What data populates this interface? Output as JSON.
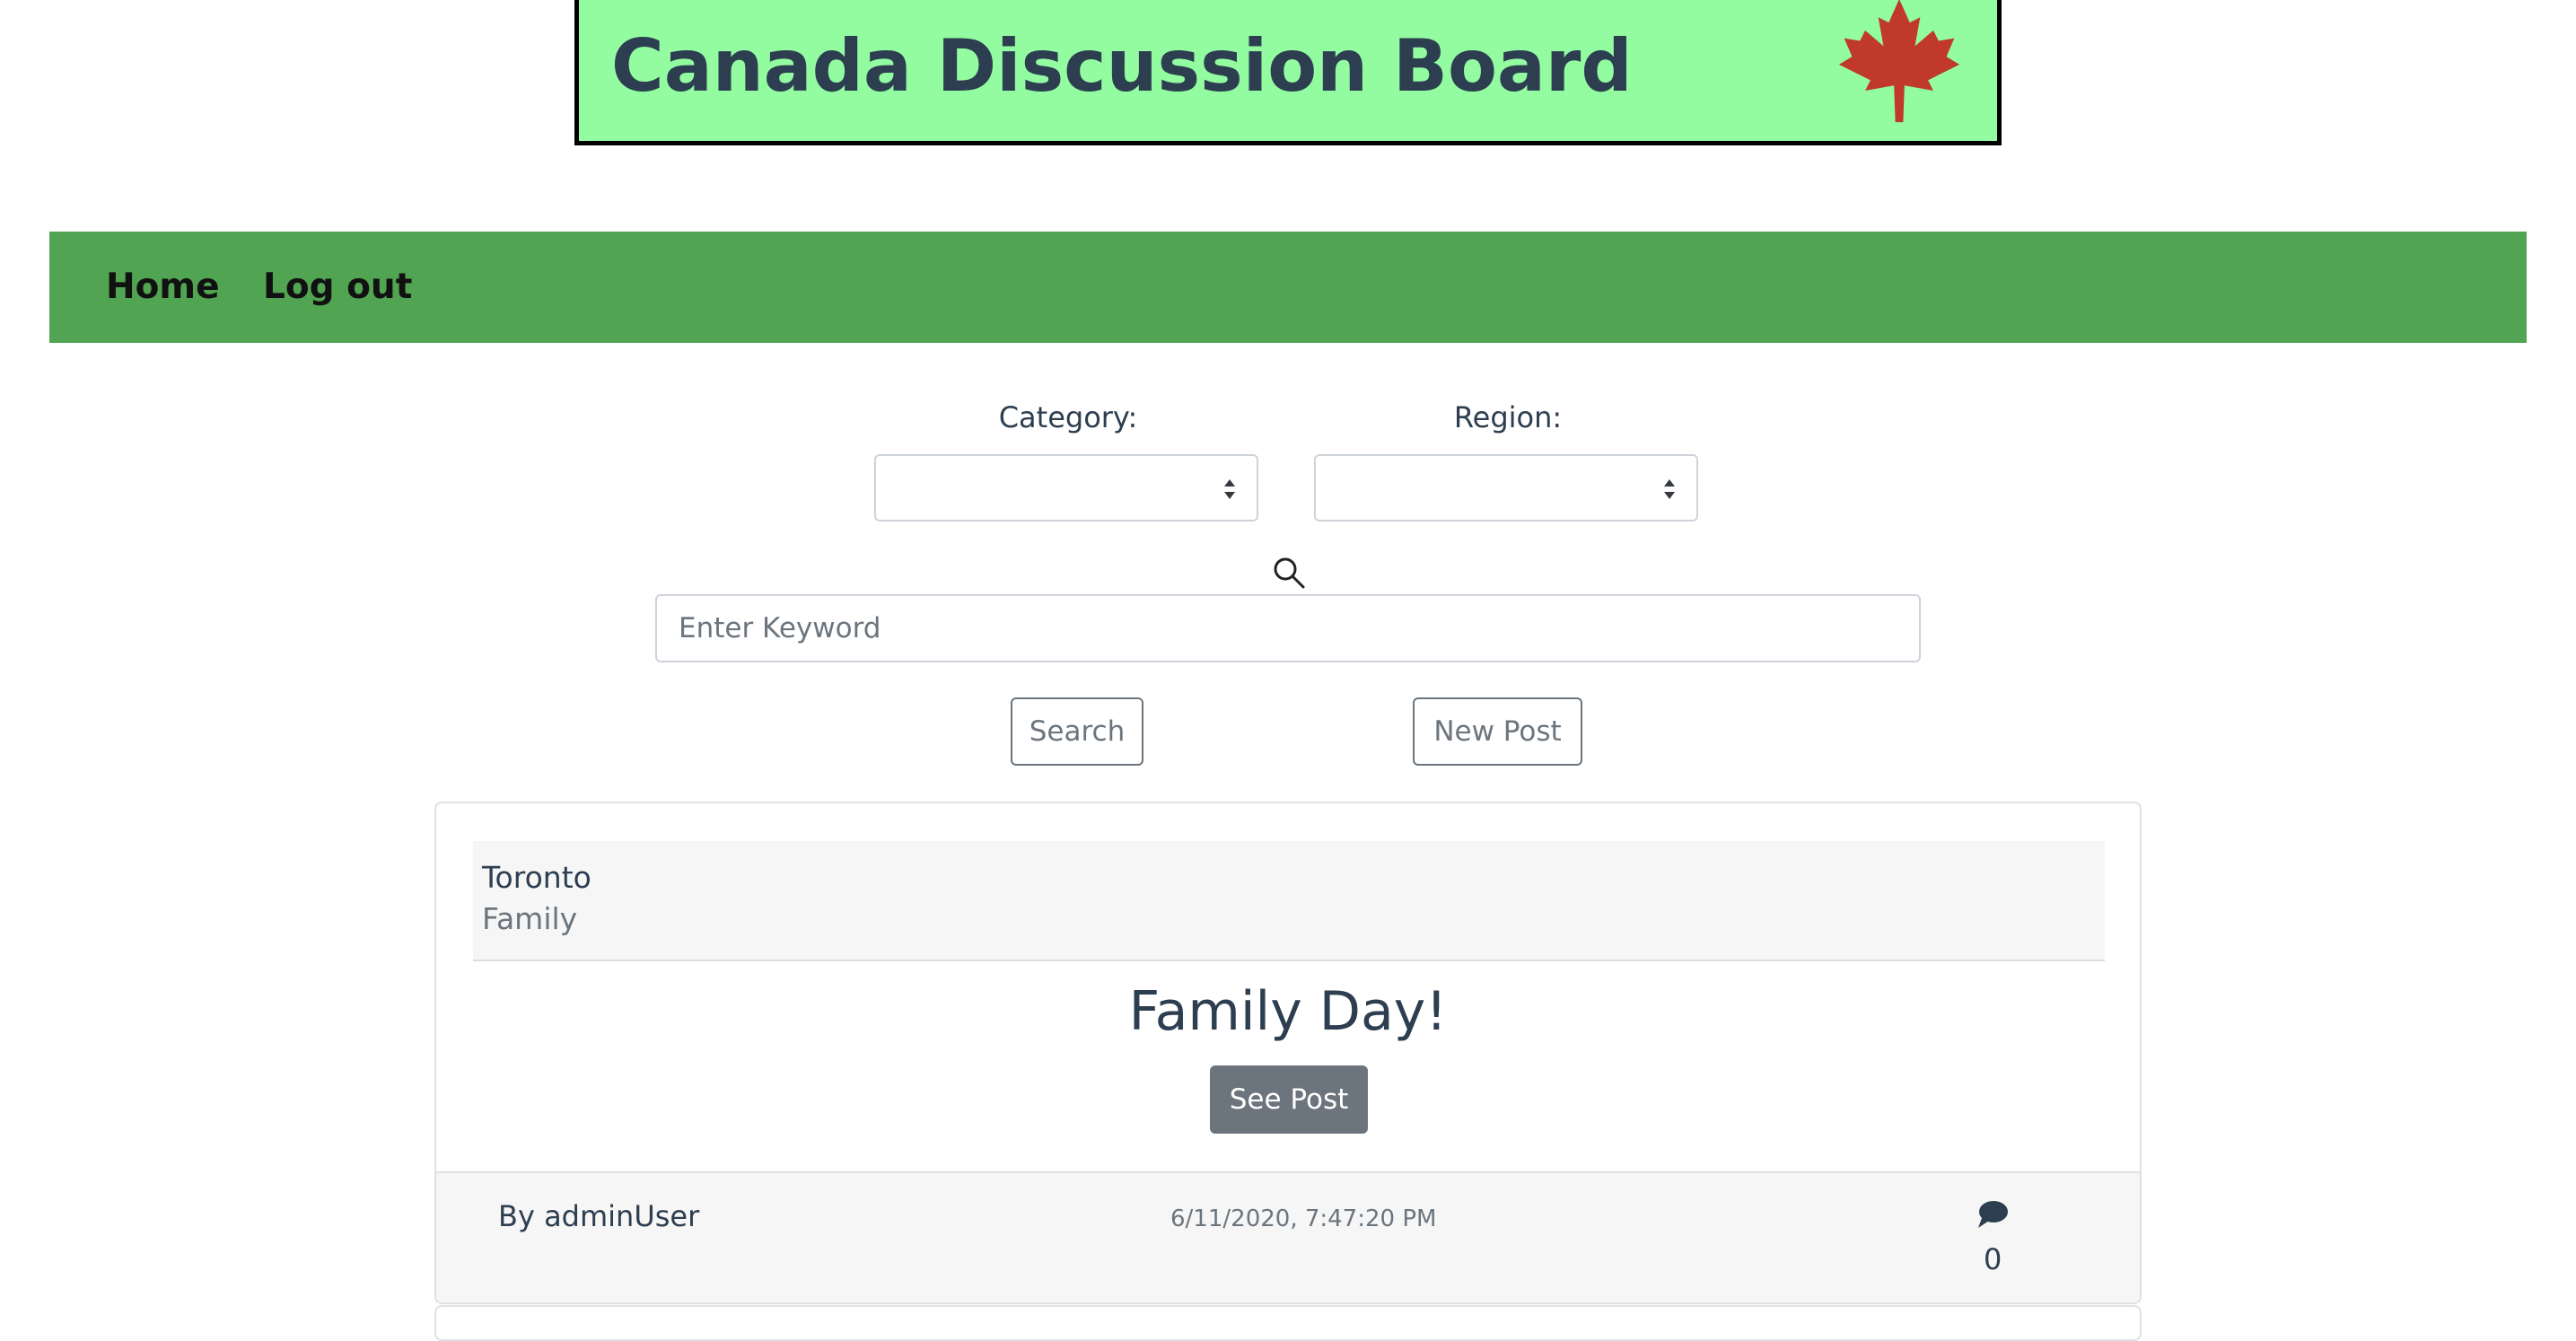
{
  "banner": {
    "title": "Canada Discussion Board",
    "logo_icon": "maple-leaf-icon",
    "background": "#93fca1"
  },
  "nav": {
    "background": "#51a451",
    "items": [
      {
        "label": "Home"
      },
      {
        "label": "Log out"
      }
    ]
  },
  "filters": {
    "category_label": "Category:",
    "category_value": "",
    "region_label": "Region:",
    "region_value": "",
    "search_icon": "search-icon",
    "keyword_placeholder": "Enter Keyword",
    "keyword_value": ""
  },
  "actions": {
    "search_label": "Search",
    "new_post_label": "New Post"
  },
  "posts": [
    {
      "region": "Toronto",
      "category": "Family",
      "title": "Family Day!",
      "see_post_label": "See Post",
      "author": "By adminUser",
      "timestamp": "6/11/2020, 7:47:20 PM",
      "comment_icon": "comment-icon",
      "comment_count": "0"
    }
  ]
}
